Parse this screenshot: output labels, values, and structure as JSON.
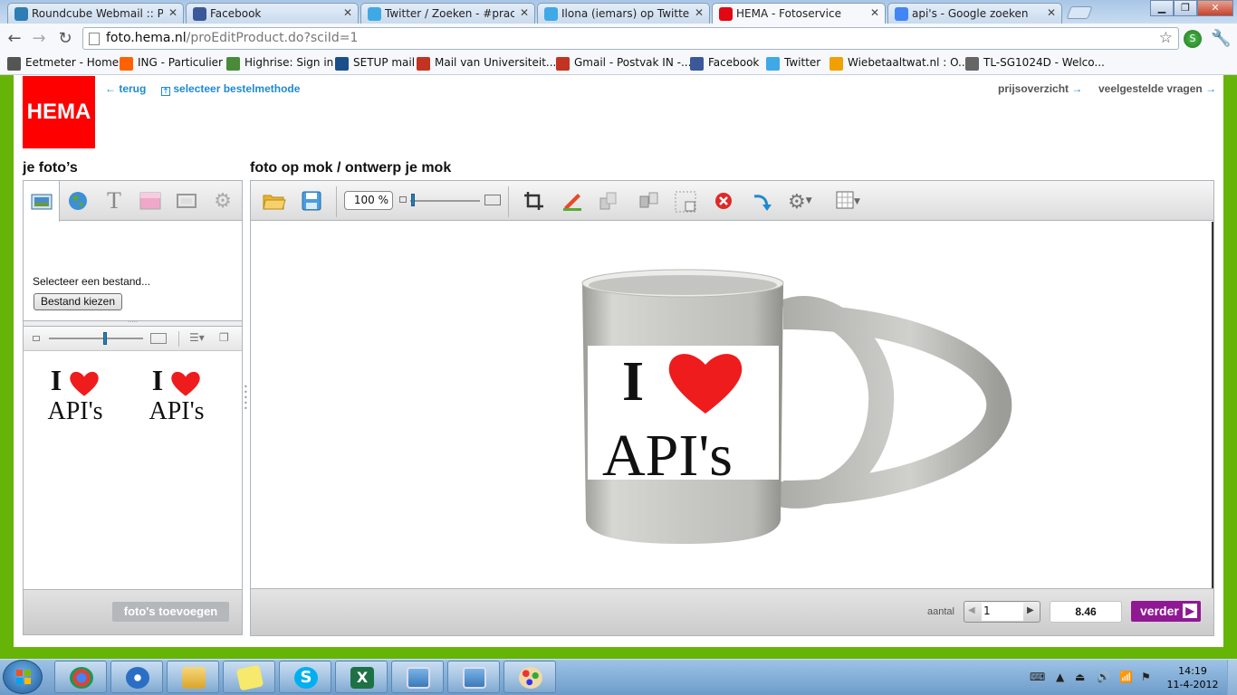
{
  "browser": {
    "tabs": [
      {
        "title": "Roundcube Webmail :: Post",
        "color": "#2e7db5",
        "active": false
      },
      {
        "title": "Facebook",
        "color": "#3b5998",
        "active": false
      },
      {
        "title": "Twitter / Zoeken - #pracnm",
        "color": "#3fa9e6",
        "active": false
      },
      {
        "title": "Ilona (iemars) op Twitter",
        "color": "#3fa9e6",
        "active": false
      },
      {
        "title": "HEMA - Fotoservice",
        "color": "#e30613",
        "active": true
      },
      {
        "title": "api's - Google zoeken",
        "color": "#4285f4",
        "active": false
      }
    ],
    "url_host": "foto.hema.nl",
    "url_path": "/proEditProduct.do?sciId=1",
    "bookmarks": [
      {
        "label": "Eetmeter - Home",
        "color": "#555555"
      },
      {
        "label": "ING - Particulier",
        "color": "#ff6200"
      },
      {
        "label": "Highrise: Sign in",
        "color": "#4a8b3a"
      },
      {
        "label": "SETUP mail",
        "color": "#1a4f8b"
      },
      {
        "label": "Mail van Universiteit...",
        "color": "#c23321"
      },
      {
        "label": "Gmail - Postvak IN -...",
        "color": "#c23321"
      },
      {
        "label": "Facebook",
        "color": "#3b5998"
      },
      {
        "label": "Twitter",
        "color": "#3fa9e6"
      },
      {
        "label": "Wiebetaaltwat.nl : O...",
        "color": "#f0a000"
      },
      {
        "label": "TL-SG1024D - Welco...",
        "color": "#666666"
      }
    ]
  },
  "hema": {
    "logo": "HEMA",
    "back": "terug",
    "select_method": "selecteer bestelmethode",
    "price_overview": "prijsoverzicht",
    "faq": "veelgestelde vragen",
    "accent": "#1e8ad2",
    "brand_red": "#ff0000"
  },
  "left": {
    "heading": "je foto’s",
    "select_file": "Selecteer een bestand...",
    "choose_file": "Bestand kiezen",
    "add_photos": "foto's toevoegen",
    "thumbnails": [
      {
        "line1": "I",
        "line2": "API's"
      },
      {
        "line1": "I",
        "line2": "API's"
      }
    ]
  },
  "editor": {
    "heading": "foto op mok / ontwerp je mok",
    "zoom": "100 %",
    "mug_text_1": "I",
    "mug_text_2": "API's",
    "quantity_label": "aantal",
    "quantity": "1",
    "price": "8.46",
    "next": "verder",
    "next_color": "#8f1893"
  },
  "taskbar": {
    "time": "14:19",
    "date": "11-4-2012"
  }
}
